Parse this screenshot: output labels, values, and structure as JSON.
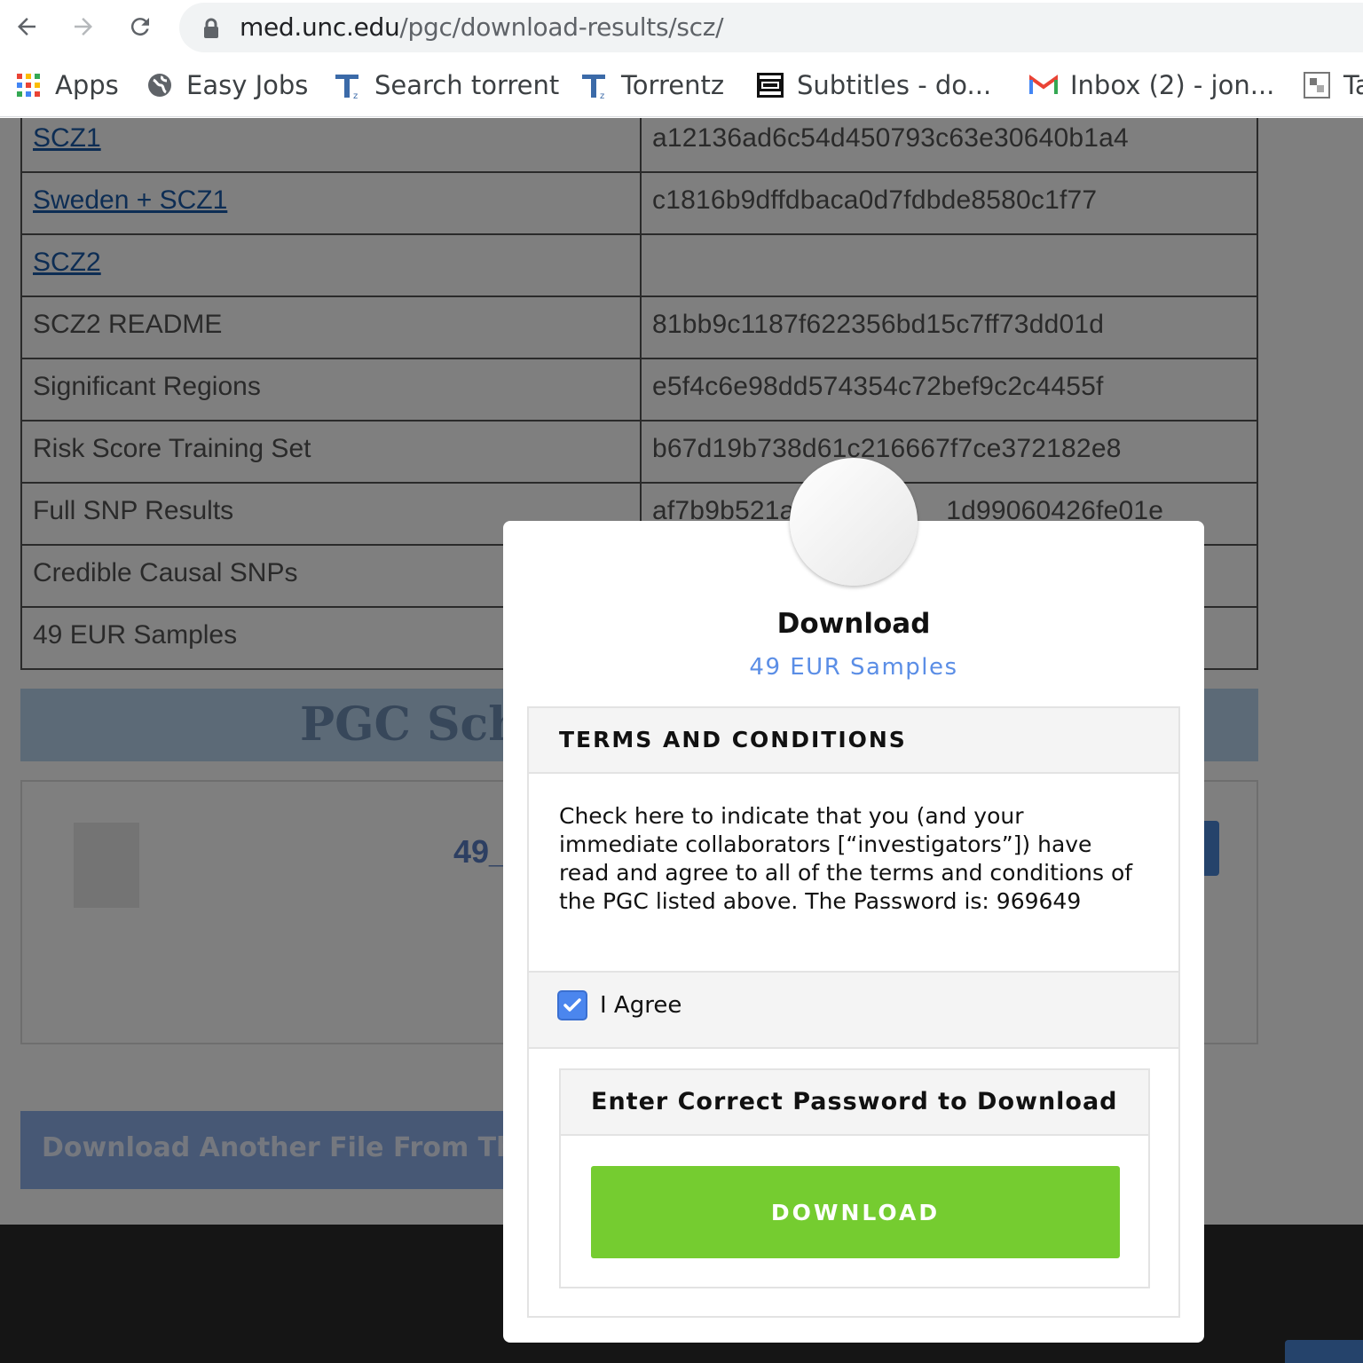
{
  "browser": {
    "url_host": "med.unc.edu",
    "url_path": "/pgc/download-results/scz/",
    "bookmarks": [
      {
        "label": "Apps",
        "icon": "apps-grid-icon"
      },
      {
        "label": "Easy Jobs",
        "icon": "globe-icon"
      },
      {
        "label": "Search torrent",
        "icon": "torrentz-icon"
      },
      {
        "label": "Torrentz",
        "icon": "torrentz-icon"
      },
      {
        "label": "Subtitles - do...",
        "icon": "subtitles-icon"
      },
      {
        "label": "Inbox (2) - jon...",
        "icon": "gmail-icon"
      },
      {
        "label": "Ta",
        "icon": "page-icon"
      }
    ]
  },
  "table": {
    "rows": [
      {
        "name": "SCZ1",
        "link": true,
        "hash": "a12136ad6c54d450793c63e30640b1a4"
      },
      {
        "name": "Sweden + SCZ1",
        "link": true,
        "hash": "c1816b9dffdbaca0d7fdbde8580c1f77"
      },
      {
        "name": "SCZ2",
        "link": true,
        "hash": ""
      },
      {
        "name": "SCZ2 README",
        "link": false,
        "hash": "81bb9c1187f622356bd15c7ff73dd01d"
      },
      {
        "name": "Significant Regions",
        "link": false,
        "hash": "e5f4c6e98dd574354c72bef9c2c4455f"
      },
      {
        "name": "Risk Score Training Set",
        "link": false,
        "hash": "b67d19b738d61c216667f7ce372182e8"
      },
      {
        "name": "Full SNP Results",
        "link": false,
        "hash": "af7b9b521a                    1d99060426fe01e"
      },
      {
        "name": "Credible Causal SNPs",
        "link": false,
        "hash": ""
      },
      {
        "name": "49 EUR Samples",
        "link": false,
        "hash": ""
      }
    ]
  },
  "page": {
    "band_title": "PGC Schi",
    "file_link": "49_",
    "another_button": "Download Another File From This Dat"
  },
  "modal": {
    "title": "Download",
    "subtitle": "49 EUR Samples",
    "terms_heading": "TERMS AND CONDITIONS",
    "terms_text": "Check here to indicate that you (and your immediate collaborators [“investigators”]) have read and agree to all of the terms and conditions of the PGC listed above. The Password is: 969649",
    "agree_label": "I Agree",
    "agree_checked": true,
    "password_heading": "Enter Correct Password to Download",
    "download_button": "DOWNLOAD"
  },
  "colors": {
    "accent_green": "#75cc30",
    "accent_blue": "#5b8ee6",
    "checkbox_blue": "#4b86ee"
  }
}
